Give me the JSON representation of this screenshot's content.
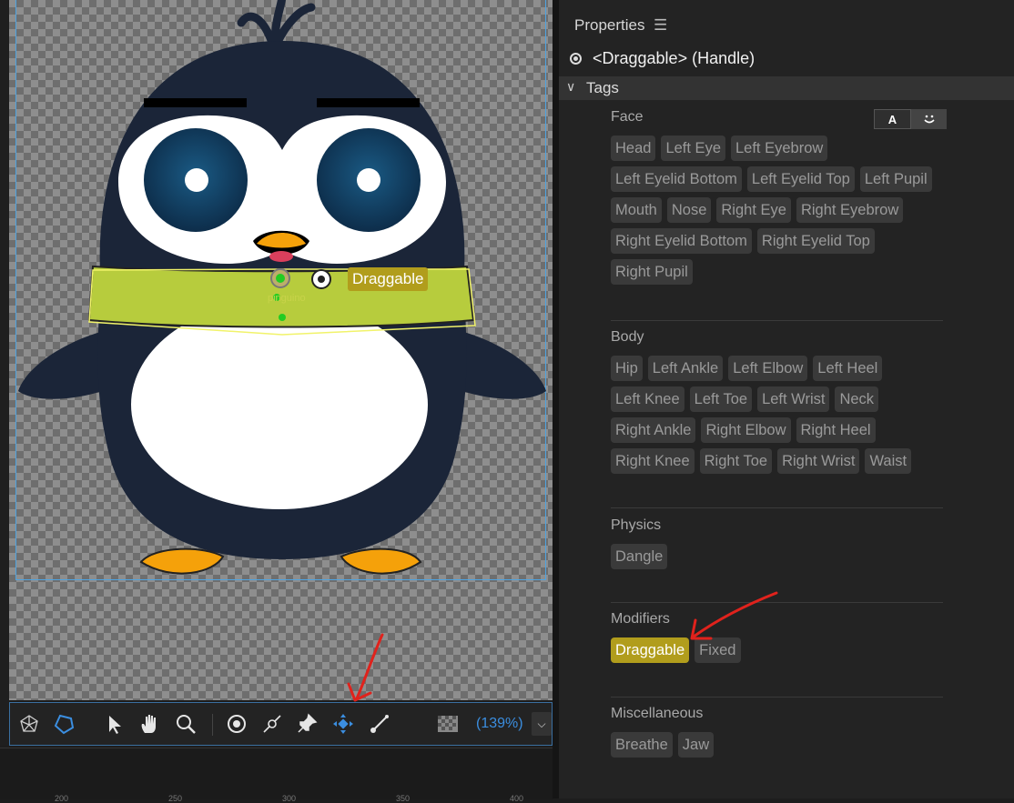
{
  "canvas": {
    "puppet_label": "pinguino",
    "handle_tag_label": "Draggable"
  },
  "toolbar": {
    "tools": [
      "perspective-icon",
      "polygon-icon",
      "select-icon",
      "hand-icon",
      "zoom-icon",
      "origin-icon",
      "dangle-icon",
      "pin-icon",
      "draggable-icon",
      "stick-icon"
    ],
    "zoom_label": "(139%)",
    "ruler_numbers": [
      "200",
      "250",
      "300",
      "350",
      "400"
    ]
  },
  "panel": {
    "title": "Properties",
    "handle_label": "<Draggable> (Handle)",
    "tags_header": "Tags",
    "face_toggle": {
      "text_label": "A",
      "icon": "smile-icon"
    },
    "sections": [
      {
        "title": "Face",
        "tags": [
          "Head",
          "Left Eye",
          "Left Eyebrow",
          "Left Eyelid Bottom",
          "Left Eyelid Top",
          "Left Pupil",
          "Mouth",
          "Nose",
          "Right Eye",
          "Right Eyebrow",
          "Right Eyelid Bottom",
          "Right Eyelid Top",
          "Right Pupil"
        ]
      },
      {
        "title": "Body",
        "tags": [
          "Hip",
          "Left Ankle",
          "Left Elbow",
          "Left Heel",
          "Left Knee",
          "Left Toe",
          "Left Wrist",
          "Neck",
          "Right Ankle",
          "Right Elbow",
          "Right Heel",
          "Right Knee",
          "Right Toe",
          "Right Wrist",
          "Waist"
        ]
      },
      {
        "title": "Physics",
        "tags": [
          "Dangle"
        ]
      },
      {
        "title": "Modifiers",
        "tags": [
          "Draggable",
          "Fixed"
        ],
        "active": "Draggable"
      },
      {
        "title": "Miscellaneous",
        "tags": [
          "Breathe",
          "Jaw"
        ]
      }
    ]
  },
  "colors": {
    "accent_yellow": "#b19d1c",
    "selection_blue": "#3b8ee0",
    "annotation_red": "#e0221c",
    "penguin_body": "#1b2538",
    "scarf": "#b7cc3d",
    "beak": "#f5a10a"
  }
}
